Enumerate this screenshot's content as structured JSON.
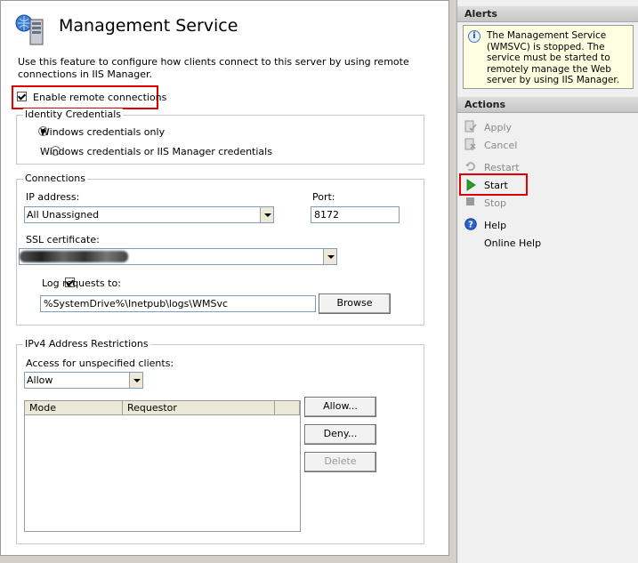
{
  "header": {
    "title": "Management Service",
    "description": "Use this feature to configure how clients connect to this server by using remote connections in IIS Manager."
  },
  "remote": {
    "enable_label": "Enable remote connections",
    "checked": true
  },
  "identity": {
    "group_label": "Identity Credentials",
    "options": [
      {
        "label": "Windows credentials only",
        "selected": true
      },
      {
        "label": "Windows credentials or IIS Manager credentials",
        "selected": false
      }
    ]
  },
  "connections": {
    "group_label": "Connections",
    "ip_label": "IP address:",
    "ip_value": "All Unassigned",
    "port_label": "Port:",
    "port_value": "8172",
    "ssl_label": "SSL certificate:",
    "log_label": "Log requests to:",
    "log_checked": true,
    "log_path": "%SystemDrive%\\Inetpub\\logs\\WMSvc",
    "browse_label": "Browse"
  },
  "ipv4": {
    "group_label": "IPv4 Address Restrictions",
    "access_label": "Access for unspecified clients:",
    "access_value": "Allow",
    "columns": [
      "Mode",
      "Requestor"
    ],
    "rows": [],
    "allow_btn": "Allow...",
    "deny_btn": "Deny...",
    "delete_btn": "Delete"
  },
  "alerts": {
    "title": "Alerts",
    "message": "The Management Service (WMSVC) is stopped. The service must be started to remotely manage the Web server by using IIS Manager."
  },
  "actions": {
    "title": "Actions",
    "apply": "Apply",
    "cancel": "Cancel",
    "restart": "Restart",
    "start": "Start",
    "stop": "Stop",
    "help": "Help",
    "online_help": "Online Help"
  },
  "colors": {
    "highlight_red": "#e00000",
    "start_green": "#2aa02a"
  }
}
